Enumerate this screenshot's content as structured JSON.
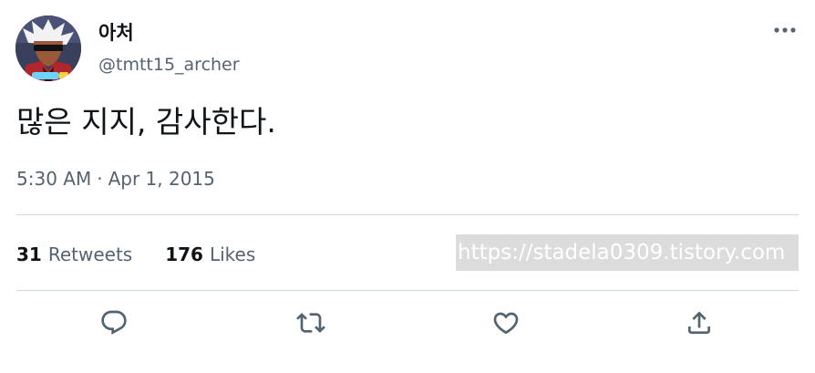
{
  "author": {
    "display_name": "아처",
    "handle": "@tmtt15_archer",
    "avatar_icon": "anime-character-avatar"
  },
  "tweet": {
    "text": "많은 지지, 감사한다.",
    "time": "5:30 AM",
    "separator": "·",
    "date": "Apr 1, 2015"
  },
  "stats": {
    "retweets_count": "31",
    "retweets_label": "Retweets",
    "likes_count": "176",
    "likes_label": "Likes"
  },
  "watermark": {
    "text": "https://stadela0309.tistory.com"
  },
  "actions": [
    {
      "name": "reply",
      "icon": "reply-icon"
    },
    {
      "name": "retweet",
      "icon": "retweet-icon"
    },
    {
      "name": "like",
      "icon": "heart-icon"
    },
    {
      "name": "share",
      "icon": "share-icon"
    }
  ],
  "colors": {
    "text_primary": "#0f1419",
    "text_secondary": "#536471",
    "divider": "#cfd9de",
    "watermark_bg": "#dcdcdc"
  }
}
